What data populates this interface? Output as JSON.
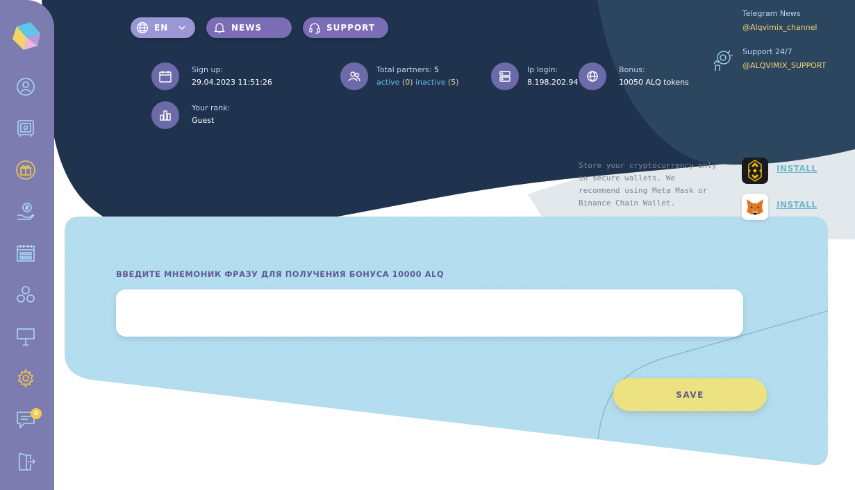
{
  "colors": {
    "sidebar": "#7d7cb1",
    "navy": "#20334e",
    "panel": "#b5deef",
    "accent_yellow": "#f1d46a",
    "save_button": "#ede282"
  },
  "sidebar": {
    "items": [
      {
        "icon": "user-icon"
      },
      {
        "icon": "safe-icon"
      },
      {
        "icon": "gift-icon"
      },
      {
        "icon": "dollar-hand-icon"
      },
      {
        "icon": "calendar-icon"
      },
      {
        "icon": "team-icon"
      },
      {
        "icon": "billboard-icon"
      },
      {
        "icon": "gear-icon"
      },
      {
        "icon": "chat-icon",
        "badge": "0"
      },
      {
        "icon": "logout-icon"
      }
    ]
  },
  "header": {
    "language": "EN",
    "news": "NEWS",
    "support": "SUPPORT"
  },
  "info": {
    "signup_label": "Sign up:",
    "signup_value": "29.04.2023 11:51:26",
    "rank_label": "Your rank:",
    "rank_value": "Guest",
    "partners_label": "Total partners:",
    "partners_total": "5",
    "active_label": "active",
    "active_count": "0",
    "inactive_label": "inactive",
    "inactive_count": "5",
    "ip_label": "Ip login:",
    "ip_value": "8.198.202.94",
    "bonus_label": "Bonus:",
    "bonus_value": "10050 ALQ tokens"
  },
  "contacts": {
    "telegram_title": "Telegram News",
    "telegram_link": "@Alqvimix_channel",
    "support_title": "Support 24/7",
    "support_link": "@ALQVIMIX_SUPPORT"
  },
  "wallets": {
    "note": "Store your cryptocurrency only in secure wallets. We recommend using Meta Mask or Binance Chain Wallet.",
    "binance_install": "INSTALL",
    "metamask_install": "INSTALL"
  },
  "form": {
    "label": "ВВЕДИТЕ МНЕМОНИК ФРАЗУ ДЛЯ ПОЛУЧЕНИЯ БОНУСА 10000 ALQ",
    "input_value": "",
    "save": "SAVE"
  }
}
